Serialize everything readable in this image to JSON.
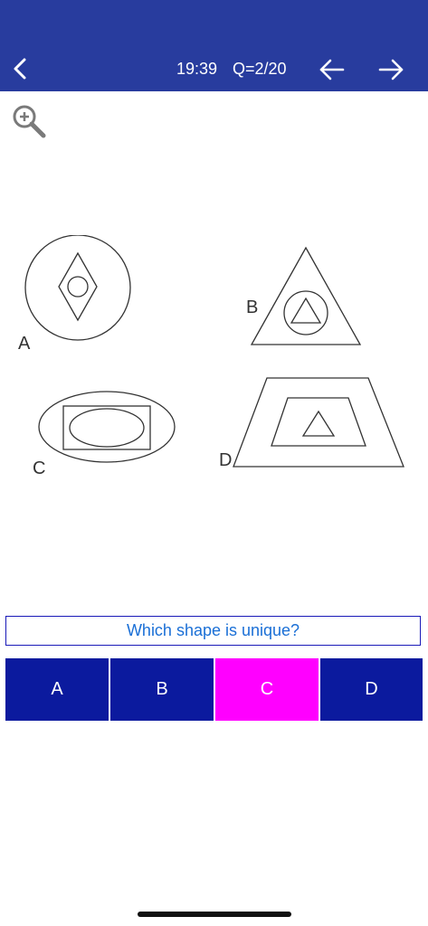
{
  "header": {
    "timer": "19:39",
    "question_counter": "Q=2/20",
    "back_icon": "chevron-left-icon",
    "prev_icon": "arrow-left-icon",
    "next_icon": "arrow-right-icon"
  },
  "toolbar": {
    "zoom_icon": "zoom-in-icon"
  },
  "figure": {
    "labels": {
      "a": "A",
      "b": "B",
      "c": "C",
      "d": "D"
    }
  },
  "question": {
    "prompt": "Which shape is unique?"
  },
  "answers": [
    {
      "label": "A",
      "selected": false
    },
    {
      "label": "B",
      "selected": false
    },
    {
      "label": "C",
      "selected": true
    },
    {
      "label": "D",
      "selected": false
    }
  ],
  "colors": {
    "header_bg": "#283c9e",
    "answer_bg": "#0b1a9e",
    "answer_selected_bg": "#ff00ff",
    "prompt_text": "#1a6fd6",
    "prompt_border": "#1a1ab8"
  }
}
